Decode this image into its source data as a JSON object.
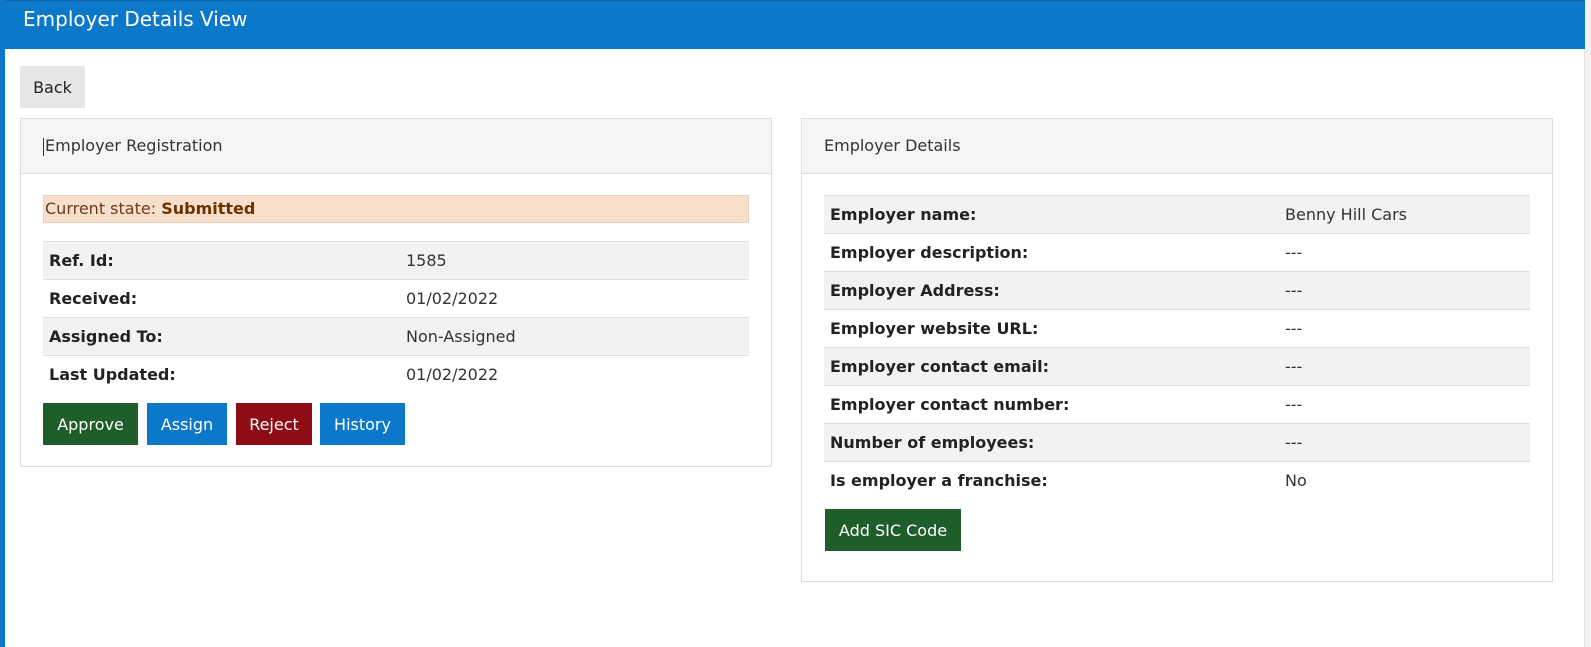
{
  "header": {
    "title": "Employer Details View"
  },
  "toolbar": {
    "back_label": "Back"
  },
  "registration": {
    "heading": "Employer Registration",
    "state_label": "Current state:",
    "state_value": "Submitted",
    "rows": [
      {
        "label": "Ref. Id:",
        "value": "1585"
      },
      {
        "label": "Received:",
        "value": "01/02/2022"
      },
      {
        "label": "Assigned To:",
        "value": "Non-Assigned"
      },
      {
        "label": "Last Updated:",
        "value": "01/02/2022"
      }
    ],
    "buttons": {
      "approve": "Approve",
      "assign": "Assign",
      "reject": "Reject",
      "history": "History"
    }
  },
  "details": {
    "heading": "Employer Details",
    "rows": [
      {
        "label": "Employer name:",
        "value": "Benny Hill Cars"
      },
      {
        "label": "Employer description:",
        "value": "---"
      },
      {
        "label": "Employer Address:",
        "value": "---"
      },
      {
        "label": "Employer website URL:",
        "value": "---"
      },
      {
        "label": "Employer contact email:",
        "value": "---"
      },
      {
        "label": "Employer contact number:",
        "value": "---"
      },
      {
        "label": "Number of employees:",
        "value": "---"
      },
      {
        "label": "Is employer a franchise:",
        "value": "No"
      }
    ],
    "add_sic_label": "Add SIC Code"
  },
  "colors": {
    "header_blue": "#0b78c9",
    "approve_green": "#1f5e2a",
    "reject_red": "#8e0d14",
    "state_bg": "#f8dfcc"
  }
}
